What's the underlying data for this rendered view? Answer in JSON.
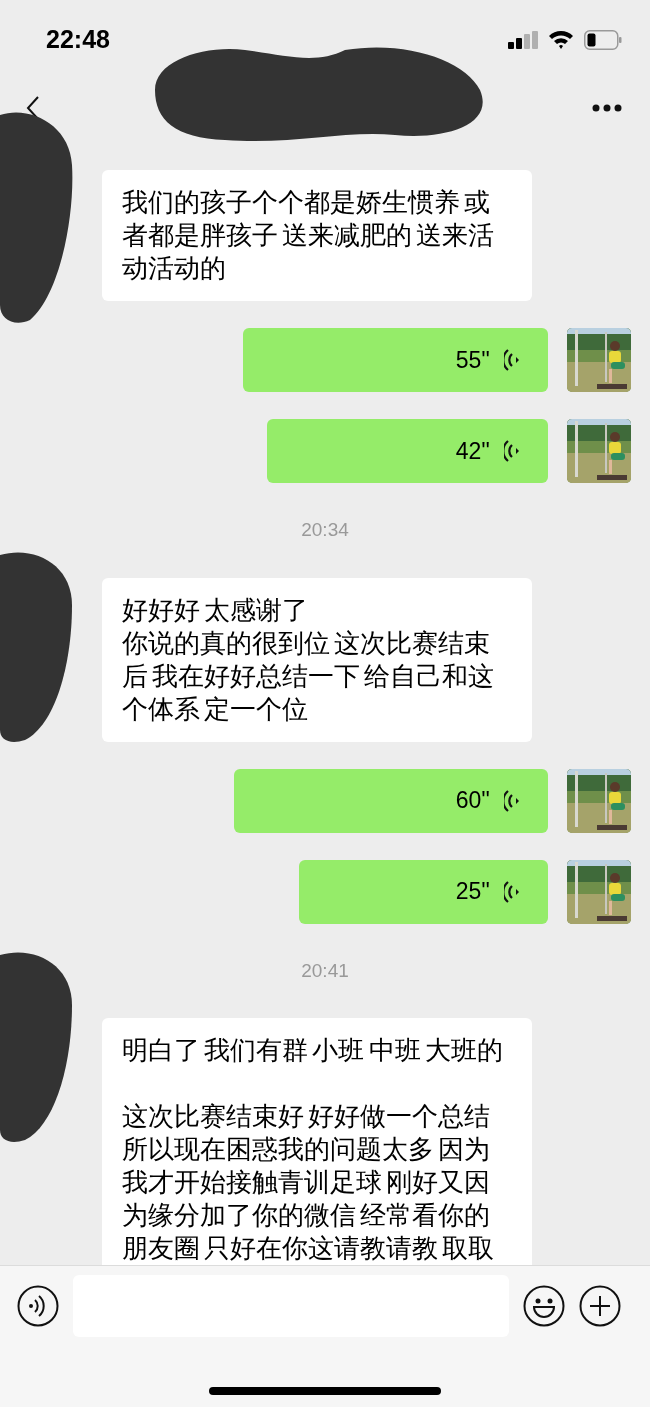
{
  "status_bar": {
    "time": "22:48"
  },
  "messages": [
    {
      "kind": "received_text",
      "paragraphs": [
        {
          "kind": "text",
          "text": "我们的孩子个个都是娇生惯养 或者都是胖孩子 送来减肥的 送来活动活动的"
        }
      ]
    },
    {
      "kind": "sent_voice",
      "duration": "55''"
    },
    {
      "kind": "sent_voice",
      "duration": "42''"
    },
    {
      "kind": "time",
      "text": "20:34"
    },
    {
      "kind": "received_text",
      "paragraphs": [
        {
          "kind": "text",
          "text": "好好好 太感谢了"
        },
        {
          "kind": "text",
          "text": "你说的真的很到位 这次比赛结束后 我在好好总结一下 给自己和这个体系 定一个位"
        }
      ]
    },
    {
      "kind": "sent_voice",
      "duration": "60''"
    },
    {
      "kind": "sent_voice",
      "duration": "25''"
    },
    {
      "kind": "time",
      "text": "20:41"
    },
    {
      "kind": "received_text",
      "paragraphs": [
        {
          "kind": "text",
          "text": "明白了 我们有群 小班 中班 大班的"
        },
        {
          "kind": "blank_line"
        },
        {
          "kind": "text",
          "text": "这次比赛结束好 好好做一个总结所以现在困惑我的问题太多 因为我才开始接触青训足球 刚好又因为缘分加了你的微信 经常看你的朋友圈 只好在你这请教请教 取取"
        }
      ]
    }
  ]
}
